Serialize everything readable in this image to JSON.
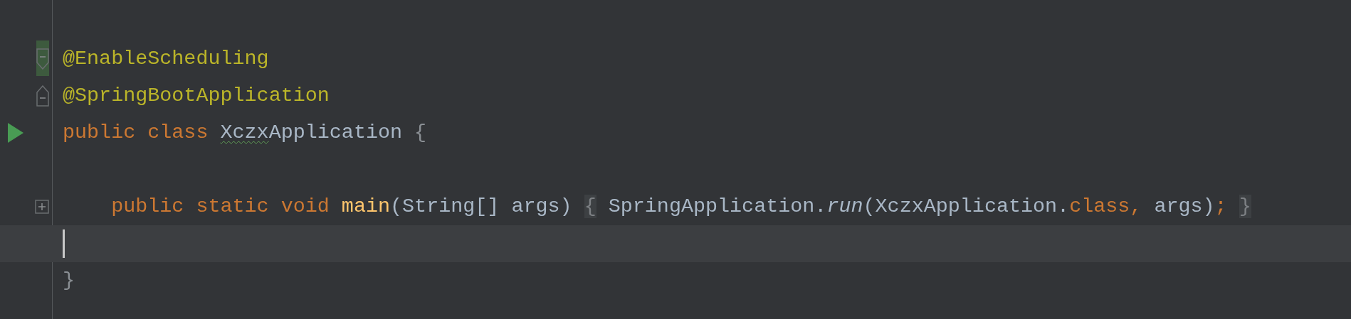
{
  "editor": {
    "lines": [
      {
        "kind": "code",
        "gutter_icon": {
          "kind": "fold-end"
        },
        "changed": true,
        "tokens": [
          {
            "text": "@EnableScheduling",
            "kind": "annotation"
          }
        ]
      },
      {
        "kind": "code",
        "gutter_icon": {
          "kind": "fold-start"
        },
        "changed": false,
        "tokens": [
          {
            "text": "@SpringBootApplication",
            "kind": "annotation"
          }
        ]
      },
      {
        "kind": "code",
        "gutter_icon": {
          "kind": "run"
        },
        "changed": false,
        "tokens": [
          {
            "text": "public class ",
            "kind": "keyword"
          },
          {
            "text": "Xczx",
            "kind": "typo"
          },
          {
            "text": "Application ",
            "kind": "plain"
          },
          {
            "text": "{",
            "kind": "brace"
          }
        ]
      },
      {
        "kind": "code",
        "changed": false
      },
      {
        "kind": "code",
        "gutter_icon": {
          "kind": "fold-collapsed"
        },
        "changed": false,
        "tokens": [
          {
            "text": "    public static void ",
            "kind": "keyword"
          },
          {
            "text": "main",
            "kind": "method"
          },
          {
            "text": "(String[] args) ",
            "kind": "plain"
          },
          {
            "text": "{",
            "kind": "folded"
          },
          {
            "text": " SpringApplication.",
            "kind": "plain"
          },
          {
            "text": "run",
            "kind": "static"
          },
          {
            "text": "(XczxApplication.",
            "kind": "plain"
          },
          {
            "text": "class, ",
            "kind": "keyword"
          },
          {
            "text": "args)",
            "kind": "plain"
          },
          {
            "text": "; ",
            "kind": "keyword"
          },
          {
            "text": "}",
            "kind": "folded"
          }
        ]
      },
      {
        "kind": "caret",
        "changed": false
      },
      {
        "kind": "code",
        "changed": false,
        "tokens": [
          {
            "text": "}",
            "kind": "brace"
          }
        ]
      }
    ]
  }
}
